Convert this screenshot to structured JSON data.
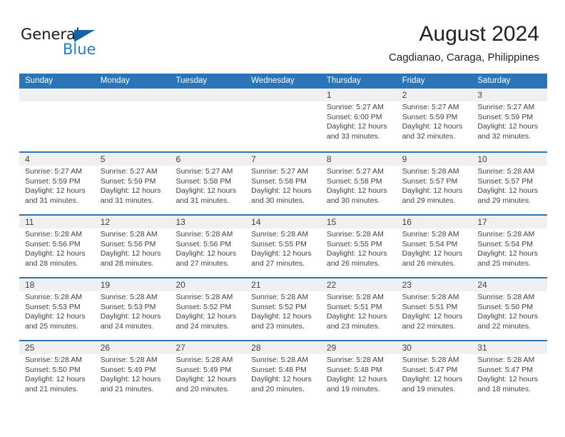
{
  "brand": {
    "name_part1": "General",
    "name_part2": "Blue",
    "triangle_color": "#1464aa",
    "blue_color": "#1f7fc6"
  },
  "header": {
    "title": "August 2024",
    "subtitle": "Cagdianao, Caraga, Philippines"
  },
  "colors": {
    "header_blue": "#2b74b8",
    "daynum_band": "#f0f0f0",
    "text": "#404040"
  },
  "calendar": {
    "weekdays": [
      "Sunday",
      "Monday",
      "Tuesday",
      "Wednesday",
      "Thursday",
      "Friday",
      "Saturday"
    ],
    "weeks": [
      [
        {
          "day": "",
          "lines": []
        },
        {
          "day": "",
          "lines": []
        },
        {
          "day": "",
          "lines": []
        },
        {
          "day": "",
          "lines": []
        },
        {
          "day": "1",
          "lines": [
            "Sunrise: 5:27 AM",
            "Sunset: 6:00 PM",
            "Daylight: 12 hours",
            "and 33 minutes."
          ]
        },
        {
          "day": "2",
          "lines": [
            "Sunrise: 5:27 AM",
            "Sunset: 5:59 PM",
            "Daylight: 12 hours",
            "and 32 minutes."
          ]
        },
        {
          "day": "3",
          "lines": [
            "Sunrise: 5:27 AM",
            "Sunset: 5:59 PM",
            "Daylight: 12 hours",
            "and 32 minutes."
          ]
        }
      ],
      [
        {
          "day": "4",
          "lines": [
            "Sunrise: 5:27 AM",
            "Sunset: 5:59 PM",
            "Daylight: 12 hours",
            "and 31 minutes."
          ]
        },
        {
          "day": "5",
          "lines": [
            "Sunrise: 5:27 AM",
            "Sunset: 5:59 PM",
            "Daylight: 12 hours",
            "and 31 minutes."
          ]
        },
        {
          "day": "6",
          "lines": [
            "Sunrise: 5:27 AM",
            "Sunset: 5:58 PM",
            "Daylight: 12 hours",
            "and 31 minutes."
          ]
        },
        {
          "day": "7",
          "lines": [
            "Sunrise: 5:27 AM",
            "Sunset: 5:58 PM",
            "Daylight: 12 hours",
            "and 30 minutes."
          ]
        },
        {
          "day": "8",
          "lines": [
            "Sunrise: 5:27 AM",
            "Sunset: 5:58 PM",
            "Daylight: 12 hours",
            "and 30 minutes."
          ]
        },
        {
          "day": "9",
          "lines": [
            "Sunrise: 5:28 AM",
            "Sunset: 5:57 PM",
            "Daylight: 12 hours",
            "and 29 minutes."
          ]
        },
        {
          "day": "10",
          "lines": [
            "Sunrise: 5:28 AM",
            "Sunset: 5:57 PM",
            "Daylight: 12 hours",
            "and 29 minutes."
          ]
        }
      ],
      [
        {
          "day": "11",
          "lines": [
            "Sunrise: 5:28 AM",
            "Sunset: 5:56 PM",
            "Daylight: 12 hours",
            "and 28 minutes."
          ]
        },
        {
          "day": "12",
          "lines": [
            "Sunrise: 5:28 AM",
            "Sunset: 5:56 PM",
            "Daylight: 12 hours",
            "and 28 minutes."
          ]
        },
        {
          "day": "13",
          "lines": [
            "Sunrise: 5:28 AM",
            "Sunset: 5:56 PM",
            "Daylight: 12 hours",
            "and 27 minutes."
          ]
        },
        {
          "day": "14",
          "lines": [
            "Sunrise: 5:28 AM",
            "Sunset: 5:55 PM",
            "Daylight: 12 hours",
            "and 27 minutes."
          ]
        },
        {
          "day": "15",
          "lines": [
            "Sunrise: 5:28 AM",
            "Sunset: 5:55 PM",
            "Daylight: 12 hours",
            "and 26 minutes."
          ]
        },
        {
          "day": "16",
          "lines": [
            "Sunrise: 5:28 AM",
            "Sunset: 5:54 PM",
            "Daylight: 12 hours",
            "and 26 minutes."
          ]
        },
        {
          "day": "17",
          "lines": [
            "Sunrise: 5:28 AM",
            "Sunset: 5:54 PM",
            "Daylight: 12 hours",
            "and 25 minutes."
          ]
        }
      ],
      [
        {
          "day": "18",
          "lines": [
            "Sunrise: 5:28 AM",
            "Sunset: 5:53 PM",
            "Daylight: 12 hours",
            "and 25 minutes."
          ]
        },
        {
          "day": "19",
          "lines": [
            "Sunrise: 5:28 AM",
            "Sunset: 5:53 PM",
            "Daylight: 12 hours",
            "and 24 minutes."
          ]
        },
        {
          "day": "20",
          "lines": [
            "Sunrise: 5:28 AM",
            "Sunset: 5:52 PM",
            "Daylight: 12 hours",
            "and 24 minutes."
          ]
        },
        {
          "day": "21",
          "lines": [
            "Sunrise: 5:28 AM",
            "Sunset: 5:52 PM",
            "Daylight: 12 hours",
            "and 23 minutes."
          ]
        },
        {
          "day": "22",
          "lines": [
            "Sunrise: 5:28 AM",
            "Sunset: 5:51 PM",
            "Daylight: 12 hours",
            "and 23 minutes."
          ]
        },
        {
          "day": "23",
          "lines": [
            "Sunrise: 5:28 AM",
            "Sunset: 5:51 PM",
            "Daylight: 12 hours",
            "and 22 minutes."
          ]
        },
        {
          "day": "24",
          "lines": [
            "Sunrise: 5:28 AM",
            "Sunset: 5:50 PM",
            "Daylight: 12 hours",
            "and 22 minutes."
          ]
        }
      ],
      [
        {
          "day": "25",
          "lines": [
            "Sunrise: 5:28 AM",
            "Sunset: 5:50 PM",
            "Daylight: 12 hours",
            "and 21 minutes."
          ]
        },
        {
          "day": "26",
          "lines": [
            "Sunrise: 5:28 AM",
            "Sunset: 5:49 PM",
            "Daylight: 12 hours",
            "and 21 minutes."
          ]
        },
        {
          "day": "27",
          "lines": [
            "Sunrise: 5:28 AM",
            "Sunset: 5:49 PM",
            "Daylight: 12 hours",
            "and 20 minutes."
          ]
        },
        {
          "day": "28",
          "lines": [
            "Sunrise: 5:28 AM",
            "Sunset: 5:48 PM",
            "Daylight: 12 hours",
            "and 20 minutes."
          ]
        },
        {
          "day": "29",
          "lines": [
            "Sunrise: 5:28 AM",
            "Sunset: 5:48 PM",
            "Daylight: 12 hours",
            "and 19 minutes."
          ]
        },
        {
          "day": "30",
          "lines": [
            "Sunrise: 5:28 AM",
            "Sunset: 5:47 PM",
            "Daylight: 12 hours",
            "and 19 minutes."
          ]
        },
        {
          "day": "31",
          "lines": [
            "Sunrise: 5:28 AM",
            "Sunset: 5:47 PM",
            "Daylight: 12 hours",
            "and 18 minutes."
          ]
        }
      ]
    ]
  }
}
